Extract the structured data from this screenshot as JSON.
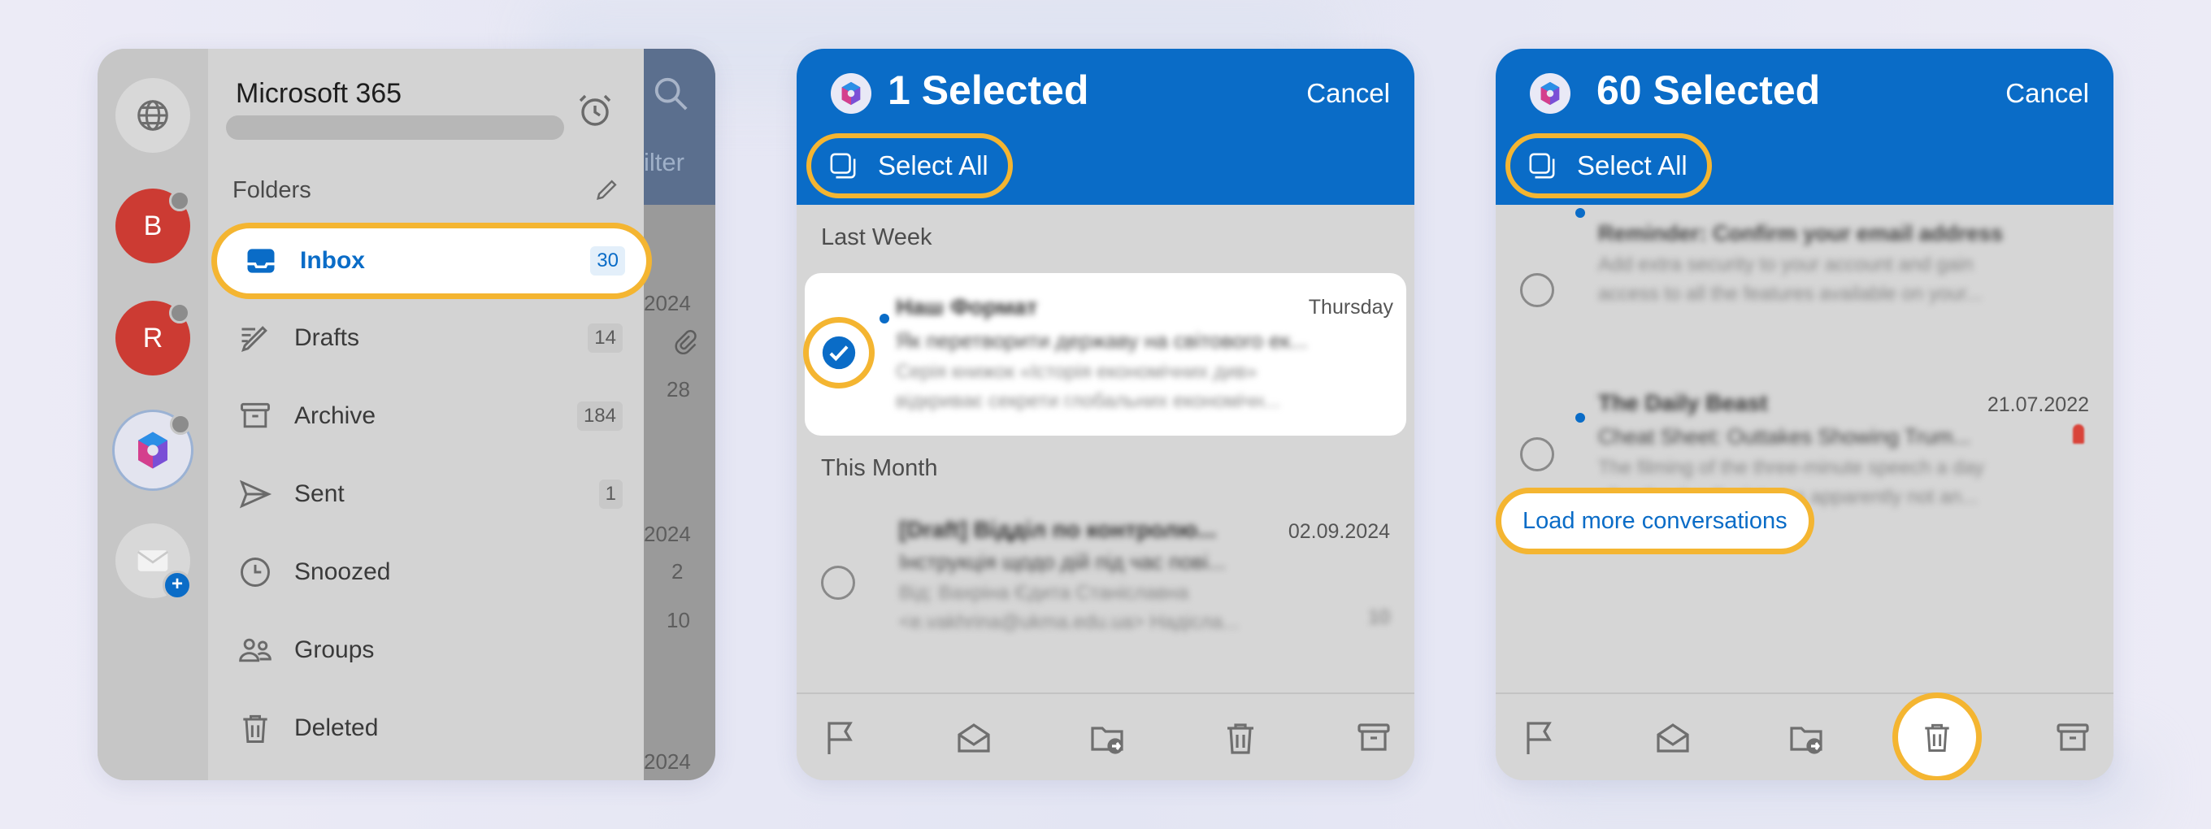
{
  "colors": {
    "accent": "#0a6cc7",
    "highlight": "#f4b531",
    "avatar_red": "#cc3b33"
  },
  "panel1": {
    "app_title": "Microsoft 365",
    "folders_label": "Folders",
    "accounts": [
      {
        "letter": "B",
        "icon": "avatar-b"
      },
      {
        "letter": "R",
        "icon": "avatar-r"
      },
      {
        "letter": "",
        "icon": "m365-logo-icon"
      },
      {
        "letter": "",
        "icon": "add-mail-account-icon"
      }
    ],
    "folders": [
      {
        "label": "Inbox",
        "count": "30",
        "icon": "inbox-icon"
      },
      {
        "label": "Drafts",
        "count": "14",
        "icon": "drafts-icon"
      },
      {
        "label": "Archive",
        "count": "184",
        "icon": "archive-icon"
      },
      {
        "label": "Sent",
        "count": "1",
        "icon": "sent-icon"
      },
      {
        "label": "Snoozed",
        "count": "",
        "icon": "snoozed-icon"
      },
      {
        "label": "Groups",
        "count": "",
        "icon": "groups-icon"
      },
      {
        "label": "Deleted",
        "count": "",
        "icon": "deleted-icon"
      }
    ],
    "behind": {
      "filter": "ilter",
      "y1": "2024",
      "n1": "28",
      "y2": "2024",
      "n2": "2",
      "n3": "10",
      "y3": "2024"
    }
  },
  "panel2": {
    "title": "1 Selected",
    "cancel": "Cancel",
    "select_all": "Select All",
    "section_last_week": "Last Week",
    "section_this_month": "This Month",
    "email1": {
      "sender": "Наш Формат",
      "date": "Thursday",
      "subject": "Як перетворити державу на світового ек...",
      "preview1": "Серія книжок «Історія економічних див»",
      "preview2": "відкриває секрети глобальних економічн...",
      "selected": true
    },
    "email2": {
      "sender": "[Draft] Відділ по контролю...",
      "date": "02.09.2024",
      "subject": "Інструкція щодо дій під час пові...",
      "preview1": "Від: Вахріна Єдита Станіславна",
      "preview2": "<e.vakhrina@ukma.edu.ua> Надісла...",
      "count": "10"
    }
  },
  "panel3": {
    "title": "60 Selected",
    "cancel": "Cancel",
    "select_all": "Select All",
    "email1": {
      "subject": "Reminder: Confirm your email address",
      "preview1": "Add extra security to your account and gain",
      "preview2": "access to all the features available on your..."
    },
    "email2": {
      "sender": "The Daily Beast",
      "date": "21.07.2022",
      "subject": "Cheat Sheet: Outtakes Showing Trum...",
      "preview1": "The filming of the three-minute speech a day",
      "preview2": "after the deadly riot was apparently not an..."
    },
    "load_more": "Load more conversations"
  },
  "toolbar_icons": [
    "flag-icon",
    "mark-read-icon",
    "move-folder-icon",
    "delete-icon",
    "archive-icon"
  ]
}
